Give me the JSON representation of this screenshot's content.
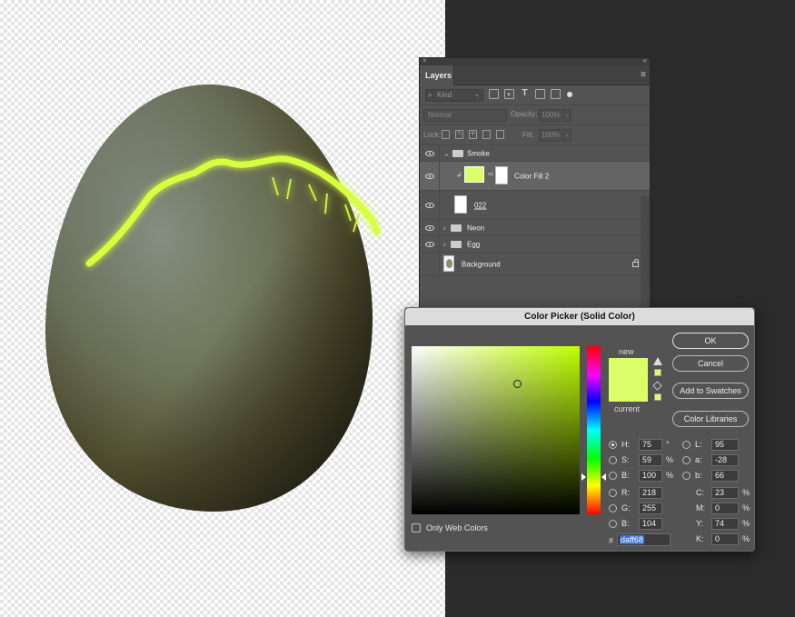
{
  "layers_panel": {
    "tab_label": "Layers",
    "filter_kind": "Kind",
    "blend_mode": "Normal",
    "opacity_label": "Opacity:",
    "opacity_value": "100%",
    "lock_label": "Lock:",
    "fill_label": "Fill:",
    "fill_value": "100%",
    "layers": [
      {
        "name": "Smoke",
        "type": "group",
        "expanded": true
      },
      {
        "name": "Color Fill 2",
        "type": "fill",
        "selected": true,
        "color": "#daff68"
      },
      {
        "name": "022",
        "type": "smart-object"
      },
      {
        "name": "Neon",
        "type": "group",
        "expanded": false
      },
      {
        "name": "Egg",
        "type": "group",
        "expanded": false
      },
      {
        "name": "Background",
        "type": "background",
        "locked": true
      }
    ]
  },
  "color_picker": {
    "title": "Color Picker (Solid Color)",
    "new_label": "new",
    "current_label": "current",
    "new_color": "#daff68",
    "current_color": "#daff68",
    "buttons": {
      "ok": "OK",
      "cancel": "Cancel",
      "add_to_swatches": "Add to Swatches",
      "color_libraries": "Color Libraries"
    },
    "hsb": {
      "h": {
        "label": "H:",
        "value": "75",
        "unit": "°"
      },
      "s": {
        "label": "S:",
        "value": "59",
        "unit": "%"
      },
      "b": {
        "label": "B:",
        "value": "100",
        "unit": "%"
      }
    },
    "rgb": {
      "r": {
        "label": "R:",
        "value": "218"
      },
      "g": {
        "label": "G:",
        "value": "255"
      },
      "b": {
        "label": "B:",
        "value": "104"
      }
    },
    "lab": {
      "l": {
        "label": "L:",
        "value": "95"
      },
      "a": {
        "label": "a:",
        "value": "-28"
      },
      "b": {
        "label": "b:",
        "value": "66"
      }
    },
    "cmyk": {
      "c": {
        "label": "C:",
        "value": "23",
        "unit": "%"
      },
      "m": {
        "label": "M:",
        "value": "0",
        "unit": "%"
      },
      "y": {
        "label": "Y:",
        "value": "74",
        "unit": "%"
      },
      "k": {
        "label": "K:",
        "value": "0",
        "unit": "%"
      }
    },
    "only_web_colors": "Only Web Colors",
    "hash": "#",
    "hex_value": "daff68"
  }
}
